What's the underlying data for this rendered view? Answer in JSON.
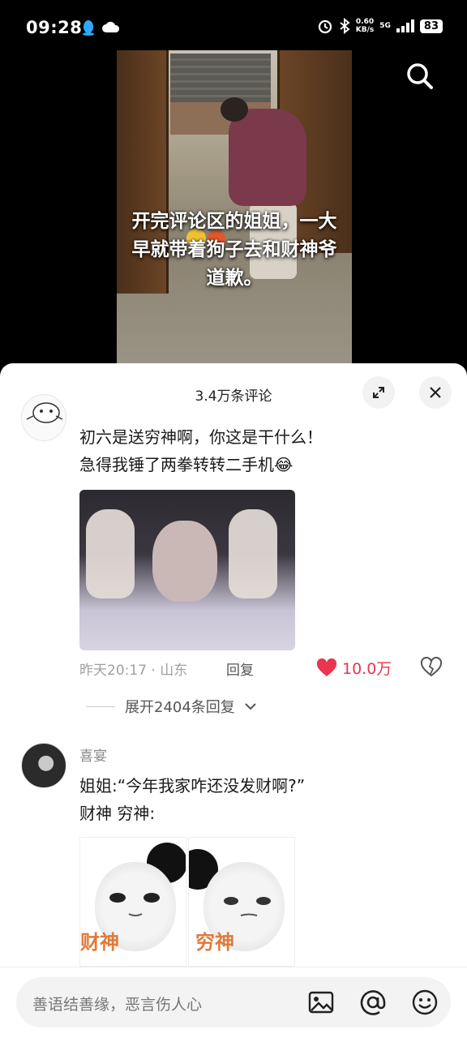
{
  "status_bar": {
    "time": "09:28",
    "net_speed": "0.60",
    "net_unit": "KB/s",
    "network": "5G",
    "battery": "83",
    "left_icons": [
      "qq-icon",
      "cloud-icon"
    ],
    "right_icons": [
      "alarm-icon",
      "bluetooth-icon",
      "signal-icon"
    ]
  },
  "video": {
    "caption": "开完评论区的姐姐，一大早就带着狗子去和财神爷道歉。",
    "search_icon": "search-icon"
  },
  "comments_panel": {
    "title": "3.4万条评论",
    "expand_icon": "expand-icon",
    "close_icon": "close-icon"
  },
  "comment1": {
    "text_line1": "初六是送穷神啊，你这是干什么！",
    "text_line2": "急得我锤了两拳转转二手机",
    "emoji": "😂",
    "time_location": "昨天20:17 · 山东",
    "reply_label": "回复",
    "likes": "10.0万",
    "expand_replies": "展开2404条回复"
  },
  "comment2": {
    "username": "喜宴",
    "text_line1": "姐姐:“今年我家咋还没发财啊?”",
    "text_line2": "财神 穷神:",
    "meme_left_label": "财神",
    "meme_right_label": "穷神"
  },
  "input": {
    "placeholder": "善语结善缘，恶言伤人心",
    "icons": [
      "image-icon",
      "mention-icon",
      "emoji-icon"
    ]
  },
  "colors": {
    "like_red": "#e8364f",
    "meme_orange": "#e07b39"
  }
}
